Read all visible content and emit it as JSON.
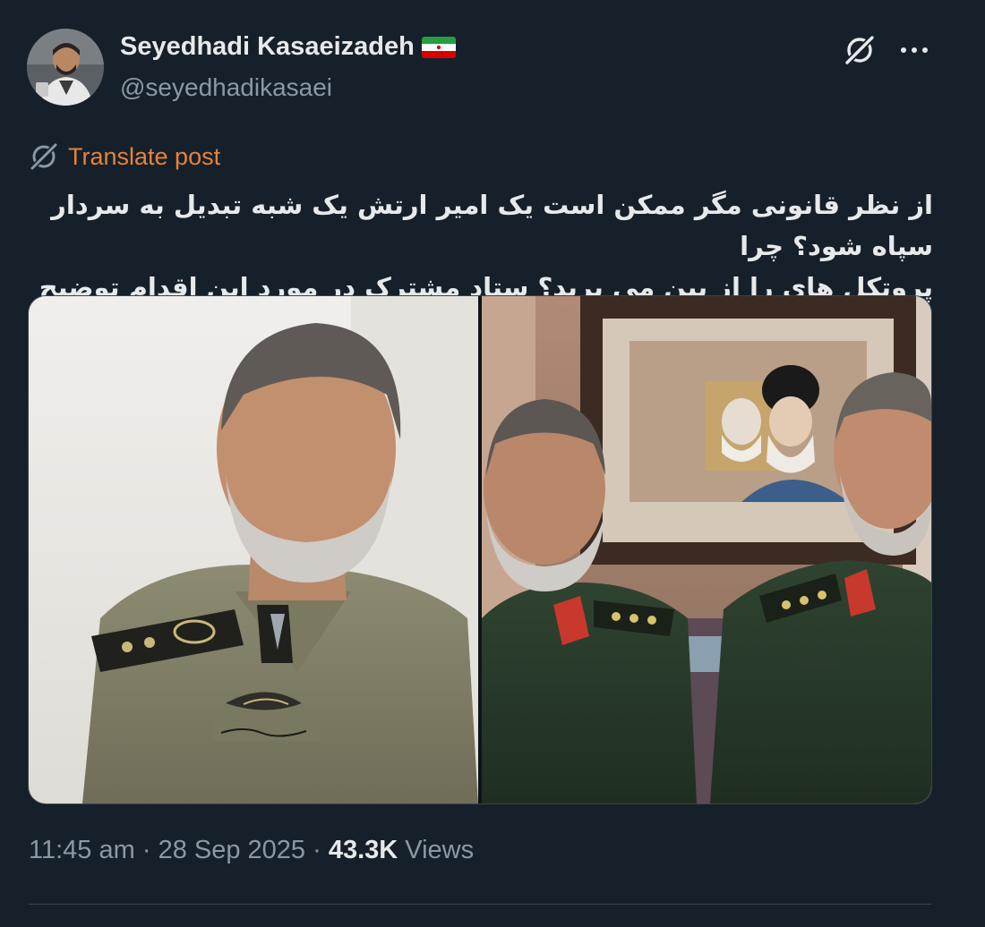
{
  "author": {
    "display_name": "Seyedhadi Kasaeizadeh",
    "handle": "@seyedhadikasaei",
    "flag_icon": "iran-flag-icon",
    "flag_colors": [
      "#239f40",
      "#ffffff",
      "#da0000"
    ]
  },
  "actions": {
    "grok_icon": "grok-icon",
    "more_icon": "more-icon"
  },
  "translate": {
    "label": "Translate post",
    "icon": "globe-icon",
    "color": "#e8823a"
  },
  "post": {
    "text_line1": "از نظر قانونی مگر ممکن است یک امیر ارتش یک شبه تبدیل به سردار سپاه شود؟ چرا",
    "text_line2": "پروتکل های را از بین می برید؟ ستاد مشترک در مورد این اقدام توضیح دهد."
  },
  "media": {
    "left_image": "photo-army-general-uniform",
    "right_image": "photo-two-irgc-officers-with-portrait"
  },
  "meta": {
    "time": "11:45 am",
    "separator": "·",
    "date": "28 Sep 2025",
    "views_count": "43.3K",
    "views_label": "Views"
  },
  "colors": {
    "background": "#15202b",
    "text_primary": "#e7e9ea",
    "text_secondary": "#8b98a5"
  }
}
